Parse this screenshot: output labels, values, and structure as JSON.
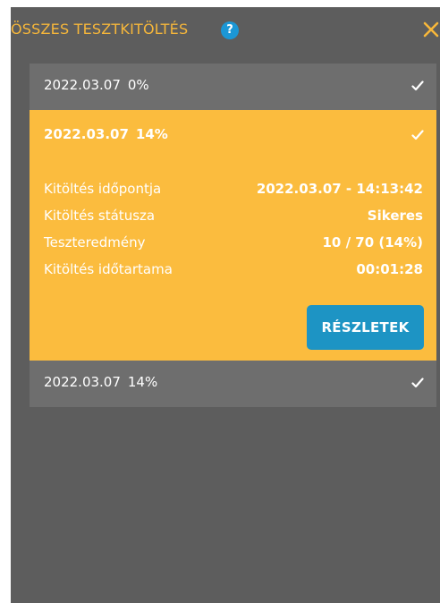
{
  "header": {
    "title": "ÖSSZES TESZTKITÖLTÉS",
    "help_icon": "question-circle-icon",
    "help_glyph": "?",
    "close_icon": "close-icon"
  },
  "colors": {
    "accent": "#fbbc3e",
    "title": "#f7b73a",
    "panel": "#5d5d5d",
    "row": "#6e6e6e",
    "button": "#1d94c4",
    "help": "#1b97d6"
  },
  "attempts": [
    {
      "date": "2022.03.07",
      "percent": "0%",
      "icon": "check-icon",
      "expanded": false
    },
    {
      "date": "2022.03.07",
      "percent": "14%",
      "icon": "check-icon",
      "expanded": true,
      "details": [
        {
          "label": "Kitöltés időpontja",
          "value": "2022.03.07 - 14:13:42"
        },
        {
          "label": "Kitöltés státusza",
          "value": "Sikeres"
        },
        {
          "label": "Teszteredmény",
          "value": "10 / 70 (14%)"
        },
        {
          "label": "Kitöltés időtartama",
          "value": "00:01:28"
        }
      ],
      "button_label": "RÉSZLETEK"
    },
    {
      "date": "2022.03.07",
      "percent": "14%",
      "icon": "check-icon",
      "expanded": false
    }
  ]
}
